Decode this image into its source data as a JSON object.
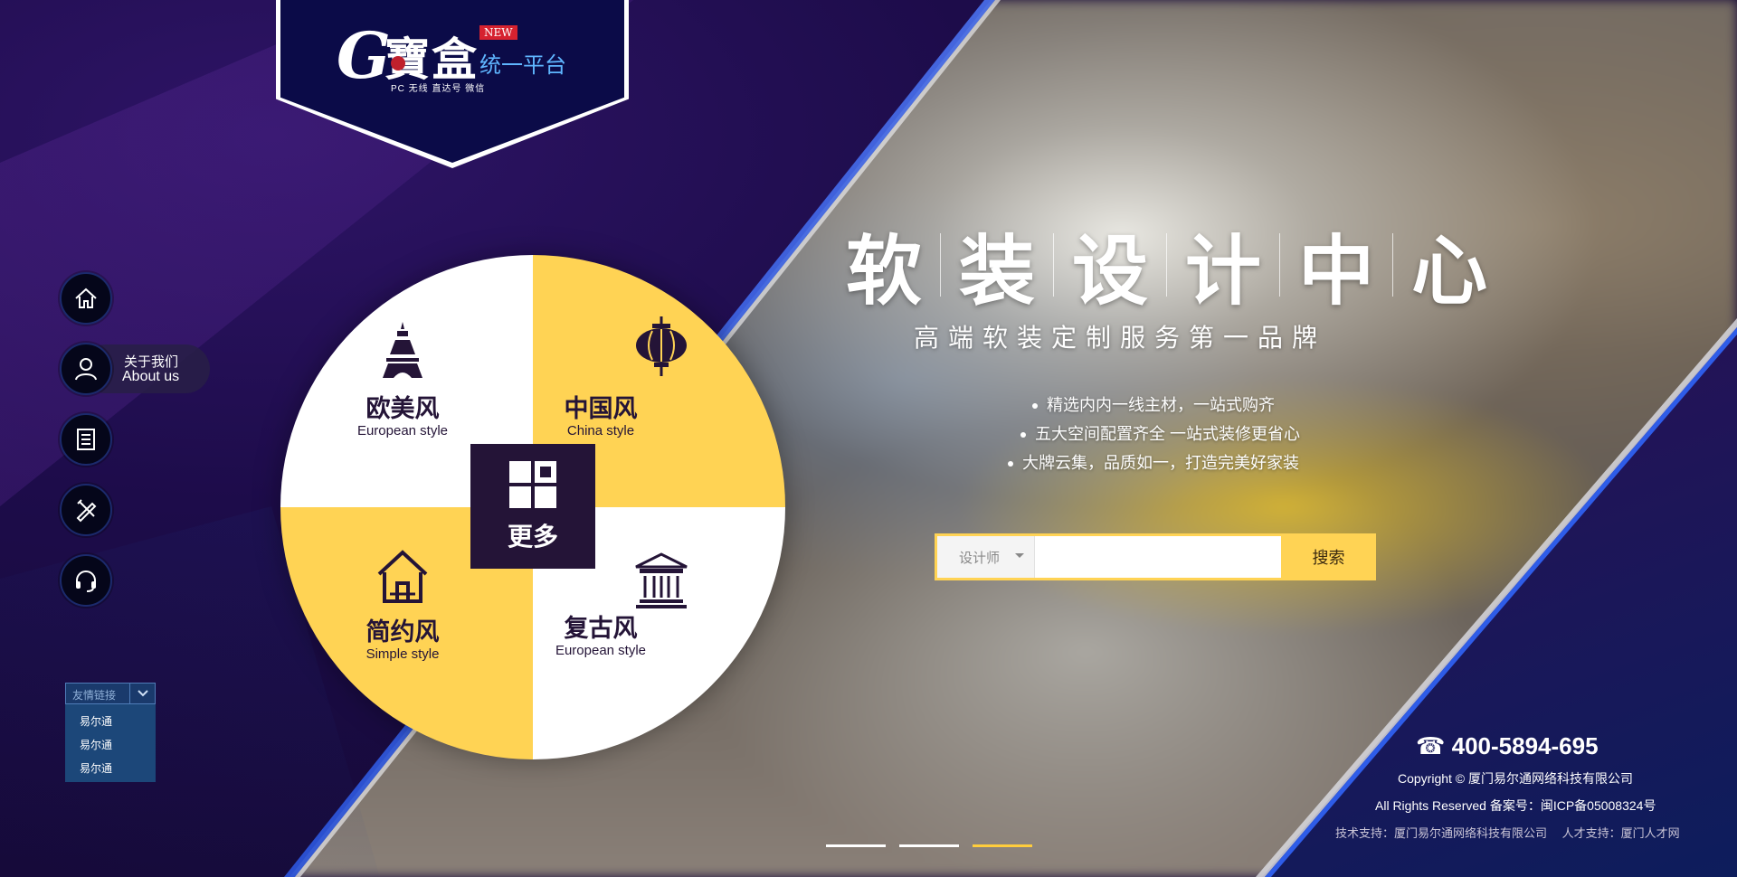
{
  "brand": {
    "logo_mark": "G",
    "logo_name": "寶盒",
    "badge": "NEW",
    "platform": "统一平台",
    "channels": "PC 无线 直达号 微信"
  },
  "side_nav": {
    "items": [
      {
        "icon": "home-icon"
      },
      {
        "icon": "user-icon",
        "label_cn": "关于我们",
        "label_en": "About us"
      },
      {
        "icon": "document-icon"
      },
      {
        "icon": "tools-icon"
      },
      {
        "icon": "headset-icon"
      }
    ]
  },
  "friend_links": {
    "title": "友情链接",
    "items": [
      "易尔通",
      "易尔通",
      "易尔通"
    ]
  },
  "styles": {
    "tl": {
      "cn": "欧美风",
      "en": "European style",
      "icon": "eiffel-tower-icon"
    },
    "tr": {
      "cn": "中国风",
      "en": "China style",
      "icon": "lantern-icon"
    },
    "bl": {
      "cn": "简约风",
      "en": "Simple style",
      "icon": "house-icon"
    },
    "br": {
      "cn": "复古风",
      "en": "European style",
      "icon": "temple-icon"
    },
    "more": "更多"
  },
  "hero": {
    "title_chars": [
      "软",
      "装",
      "设",
      "计",
      "中",
      "心"
    ],
    "subtitle": "高端软装定制服务第一品牌",
    "bullets": [
      "精选内内一线主材，一站式购齐",
      "五大空间配置齐全 一站式装修更省心",
      "大牌云集，品质如一，打造完美好家装"
    ]
  },
  "search": {
    "category": "设计师",
    "placeholder": "",
    "button": "搜索"
  },
  "footer": {
    "phone": "400-5894-695",
    "copyright": "Copyright © 厦门易尔通网络科技有限公司",
    "rights": "All Rights Reserved 备案号：闽ICP备05008324号",
    "support": "技术支持：厦门易尔通网络科技有限公司　 人才支持：厦门人才网"
  },
  "slider": {
    "count": 3,
    "active": 3
  },
  "colors": {
    "navy": "#160a3a",
    "yellow": "#ffd354",
    "dark_purple": "#241437",
    "accent_blue": "#2e5ce8"
  }
}
